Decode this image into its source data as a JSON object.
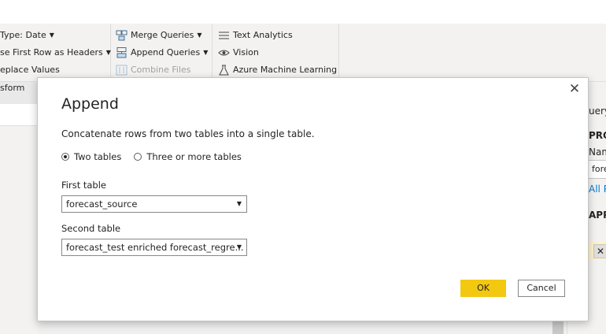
{
  "ribbon": {
    "col1": {
      "data_type": "Type: Date",
      "first_row": "se First Row as Headers",
      "replace_values": "eplace Values",
      "group_label": "sform"
    },
    "col2": {
      "merge_queries": "Merge Queries",
      "append_queries": "Append Queries",
      "combine_files": "Combine Files"
    },
    "col3": {
      "text_analytics": "Text Analytics",
      "vision": "Vision",
      "azure_ml": "Azure Machine Learning"
    }
  },
  "right_pane": {
    "header": "uery",
    "properties": "PRO",
    "name_label": "Nam",
    "name_value": "fore",
    "all_properties": "All P",
    "applied_steps": "APP"
  },
  "dialog": {
    "title": "Append",
    "description": "Concatenate rows from two tables into a single table.",
    "radio_two": "Two tables",
    "radio_three": "Three or more tables",
    "selected_mode": "Two tables",
    "first_table_label": "First table",
    "first_table_value": "forecast_source",
    "second_table_label": "Second table",
    "second_table_value": "forecast_test enriched forecast_regre...",
    "ok_label": "OK",
    "cancel_label": "Cancel",
    "close_glyph": "✕"
  },
  "colors": {
    "accent": "#f2c811",
    "link": "#0078d4",
    "ribbon_bg": "#f3f2f1"
  }
}
